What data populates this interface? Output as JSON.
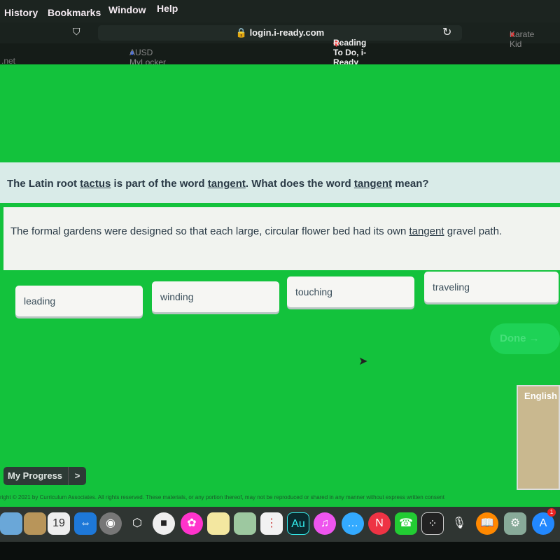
{
  "menubar": {
    "items": [
      "History",
      "Bookmarks",
      "Window",
      "Help"
    ]
  },
  "browser": {
    "url": "login.i-ready.com",
    "tabs": [
      ".net",
      "AUSD MyLocker",
      "Reading To Do, i-Ready",
      "Karate Kid"
    ]
  },
  "question": {
    "pre": "The Latin root ",
    "root": "tactus",
    "mid": " is part of the word ",
    "word": "tangent",
    "mid2": ". What does the word ",
    "word2": "tangent",
    "post": " mean?"
  },
  "passage": {
    "pre": "The formal gardens were designed so that each large, circular flower bed had its own ",
    "word": "tangent",
    "post": " gravel path."
  },
  "answers": [
    "leading",
    "winding",
    "touching",
    "traveling"
  ],
  "done_label": "Done →",
  "video_label": "English",
  "my_progress": {
    "label": "My Progress",
    "arrow": ">"
  },
  "copyright": "right © 2021 by Curriculum Associates. All rights reserved. These materials, or any portion thereof, may not be reproduced or shared in any manner without express written consent",
  "dock": {
    "calendar_day": "19",
    "audition": "Au",
    "appstore_badge": "1"
  },
  "colors": {
    "background": "#13c23c",
    "question_bg": "#d9ebe8"
  }
}
